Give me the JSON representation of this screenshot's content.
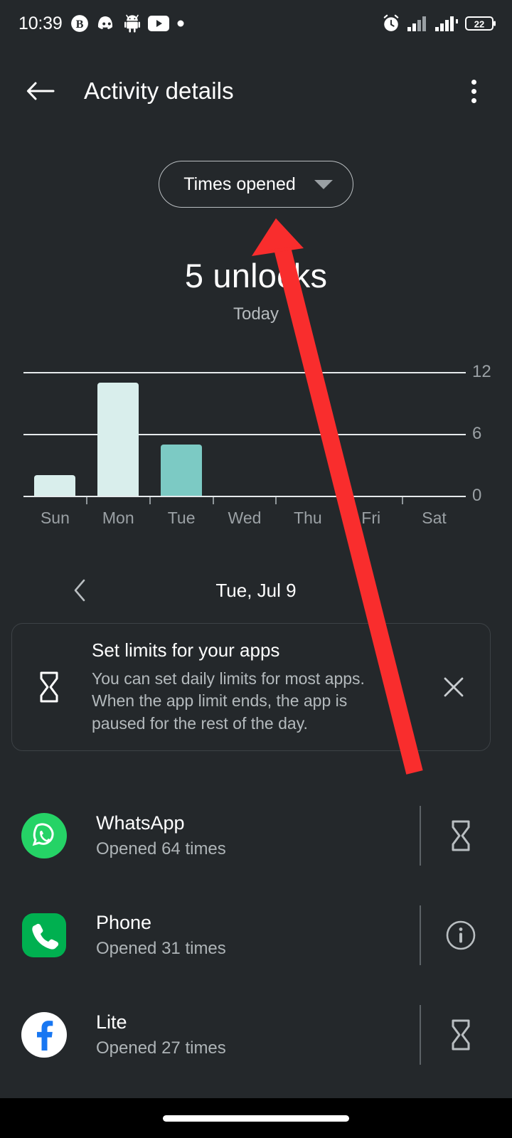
{
  "status_bar": {
    "time": "10:39",
    "left_icons": [
      "bitcoin-icon",
      "discord-icon",
      "android-icon",
      "youtube-icon",
      "dot-icon"
    ],
    "right_icons": [
      "alarm-icon",
      "signal-sim1-icon",
      "signal-sim2-icon"
    ],
    "battery_level": "22"
  },
  "app_bar": {
    "back_icon": "back-arrow-icon",
    "title": "Activity details",
    "overflow_icon": "more-vertical-icon"
  },
  "metric_selector": {
    "label": "Times opened",
    "caret_icon": "chevron-down-icon"
  },
  "summary": {
    "headline": "5 unlocks",
    "subhead": "Today"
  },
  "chart_data": {
    "type": "bar",
    "title": "5 unlocks",
    "subtitle": "Today",
    "categories": [
      "Sun",
      "Mon",
      "Tue",
      "Wed",
      "Thu",
      "Fri",
      "Sat"
    ],
    "values": [
      2,
      11,
      5,
      0,
      0,
      0,
      0
    ],
    "highlight_index": 2,
    "bar_color": "#d9eeec",
    "highlight_color": "#7ccac4",
    "xlabel": "",
    "ylabel": "",
    "ylim": [
      0,
      13.8
    ],
    "yticks": [
      0,
      6,
      12
    ],
    "ytick_labels": [
      "0",
      "6",
      "12"
    ],
    "grid": true,
    "legend": false,
    "axis_color": "#e6eaec",
    "label_color": "#9ba1a5"
  },
  "date_nav": {
    "prev_icon": "chevron-left-icon",
    "date": "Tue, Jul 9"
  },
  "banner": {
    "icon": "hourglass-icon",
    "title": "Set limits for your apps",
    "body": "You can set daily limits for most apps.\nWhen the app limit ends, the app is\npaused for the rest of the day.",
    "close_icon": "close-icon"
  },
  "app_list": [
    {
      "name": "WhatsApp",
      "subtitle": "Opened 64 times",
      "icon": "whatsapp-icon",
      "icon_color": "#25D366",
      "action_icon": "hourglass-icon"
    },
    {
      "name": "Phone",
      "subtitle": "Opened 31 times",
      "icon": "phone-icon",
      "icon_color": "#00B050",
      "action_icon": "info-icon"
    },
    {
      "name": "Lite",
      "subtitle": "Opened 27 times",
      "icon": "facebook-lite-icon",
      "icon_color": "#1877F2",
      "action_icon": "hourglass-icon"
    }
  ],
  "annotation": {
    "type": "arrow",
    "color": "#f92d2d",
    "points_to": "metric-selector-chip"
  },
  "nav_bar": {
    "gesture_pill": "home-indicator"
  },
  "theme": {
    "background": "#24282b",
    "nav_background": "#000000",
    "text_primary": "#ffffff",
    "text_secondary": "#aeb4b7",
    "divider": "#3d4246"
  }
}
